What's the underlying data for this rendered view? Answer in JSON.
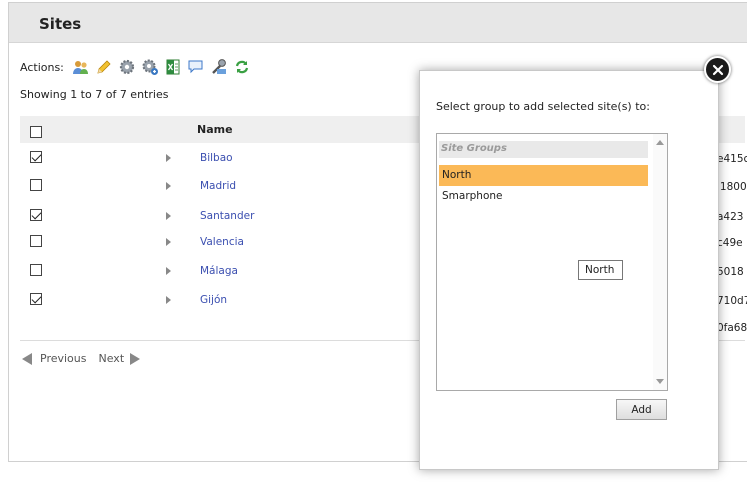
{
  "panel": {
    "title": "Sites"
  },
  "actions": {
    "label": "Actions:",
    "icons": [
      "users-icon",
      "pencil-icon",
      "gear-icon",
      "gear-add-icon",
      "excel-export-icon",
      "comment-icon",
      "tool-icon",
      "refresh-icon"
    ]
  },
  "showing_text": "Showing 1 to 7 of 7 entries",
  "table": {
    "header_name": "Name",
    "rows": [
      {
        "checked": true,
        "name": "Bilbao",
        "id_fragment": "e415c"
      },
      {
        "checked": false,
        "name": "Madrid",
        "id_fragment": "l1800"
      },
      {
        "checked": true,
        "name": "Santander",
        "id_fragment": "a423"
      },
      {
        "checked": false,
        "name": "Valencia",
        "id_fragment": "c49e"
      },
      {
        "checked": false,
        "name": "Málaga",
        "id_fragment": "5018"
      },
      {
        "checked": true,
        "name": "Gijón",
        "id_fragment": "710d7"
      },
      {
        "checked": null,
        "name": "",
        "id_fragment": "0fa68"
      }
    ]
  },
  "pager": {
    "previous": "Previous",
    "next": "Next"
  },
  "modal": {
    "prompt": "Select group to add selected site(s) to:",
    "group_label": "Site Groups",
    "options": [
      {
        "label": "North",
        "selected": true
      },
      {
        "label": "Smarphone",
        "selected": false
      }
    ],
    "tooltip": "North",
    "add_button": "Add"
  },
  "colors": {
    "link": "#3b4fb0",
    "selected_option": "#fbb957",
    "header_bg": "#e7e7e7"
  }
}
